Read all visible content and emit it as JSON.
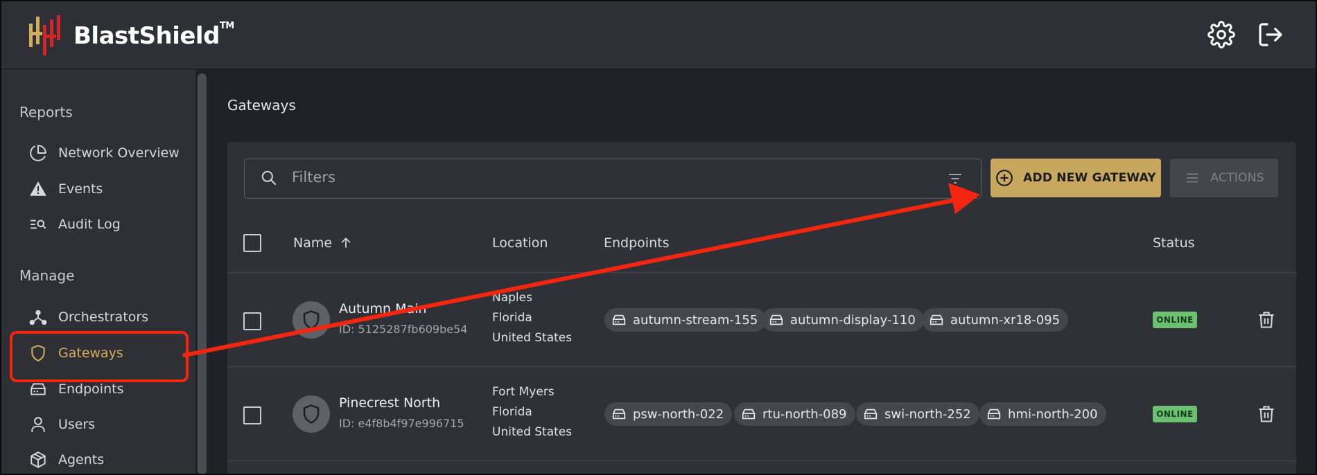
{
  "app": {
    "brand": "BlastShield",
    "brand_tm": "TM"
  },
  "header": {
    "settings_icon": "gear-icon",
    "logout_icon": "logout-icon"
  },
  "sidebar": {
    "sections": [
      {
        "label": "Reports"
      },
      {
        "label": "Manage"
      }
    ],
    "items": [
      {
        "label": "Network Overview",
        "icon": "pie-chart-icon"
      },
      {
        "label": "Events",
        "icon": "warning-icon"
      },
      {
        "label": "Audit Log",
        "icon": "audit-log-icon"
      },
      {
        "label": "Orchestrators",
        "icon": "orchestrator-icon"
      },
      {
        "label": "Gateways",
        "icon": "shield-icon",
        "active": true
      },
      {
        "label": "Endpoints",
        "icon": "endpoint-drive-icon"
      },
      {
        "label": "Users",
        "icon": "user-icon"
      },
      {
        "label": "Agents",
        "icon": "package-icon"
      }
    ]
  },
  "main": {
    "title": "Gateways",
    "filter": {
      "placeholder": "Filters"
    },
    "add_button": "ADD NEW GATEWAY",
    "actions_button": "ACTIONS",
    "columns": {
      "name": "Name",
      "location": "Location",
      "endpoints": "Endpoints",
      "status": "Status"
    },
    "rows": [
      {
        "name": "Autumn Main",
        "id": "ID: 5125287fb609be54",
        "location": [
          "Naples",
          "Florida",
          "United States"
        ],
        "endpoints": [
          "autumn-stream-155",
          "autumn-display-110",
          "autumn-xr18-095"
        ],
        "status": "ONLINE"
      },
      {
        "name": "Pinecrest North",
        "id": "ID: e4f8b4f97e996715",
        "location": [
          "Fort Myers",
          "Florida",
          "United States"
        ],
        "endpoints": [
          "psw-north-022",
          "rtu-north-089",
          "swi-north-252",
          "hmi-north-200"
        ],
        "status": "ONLINE"
      }
    ]
  },
  "colors": {
    "accent": "#c8a75f",
    "online": "#6cc071",
    "annotation": "#f5260f"
  }
}
